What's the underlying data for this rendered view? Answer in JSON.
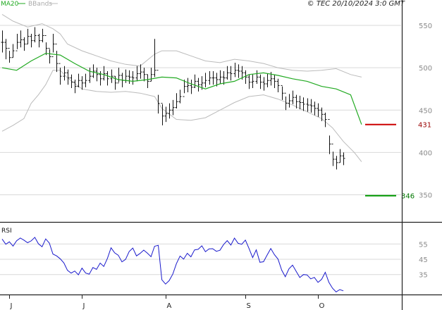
{
  "header": {
    "ma_label": "MA20",
    "bb_label": "BBands",
    "copyright": "© TEC 20/10/2024 3:0 GMT"
  },
  "colors": {
    "ma": "#22aa22",
    "bbands": "#bbbbbb",
    "bars": "#111111",
    "rsi": "#1a1acc",
    "resistance": "#cc0000",
    "support": "#009900",
    "grid": "#d9d9d9",
    "axis": "#222222"
  },
  "chart_data": [
    {
      "type": "ohlc",
      "price_axis": {
        "ylim": [
          318,
          565
        ],
        "ticks": [
          550,
          500,
          450,
          400,
          350
        ]
      },
      "x_labels": [
        {
          "label": "J",
          "index": 0
        },
        {
          "label": "J",
          "index": 20
        },
        {
          "label": "A",
          "index": 43
        },
        {
          "label": "S",
          "index": 65
        },
        {
          "label": "O",
          "index": 85
        }
      ],
      "last_index": 99,
      "close": [
        530,
        523,
        512,
        520,
        530,
        533,
        528,
        537,
        532,
        538,
        532,
        538,
        523,
        513,
        528,
        505,
        490,
        494,
        488,
        483,
        478,
        485,
        482,
        485,
        490,
        496,
        492,
        487,
        493,
        487,
        490,
        482,
        491,
        485,
        490,
        489,
        488,
        493,
        495,
        492,
        484,
        492,
        497,
        458,
        443,
        446,
        450,
        453,
        460,
        466,
        478,
        479,
        477,
        484,
        480,
        482,
        485,
        488,
        488,
        486,
        489,
        488,
        494,
        493,
        497,
        496,
        494,
        489,
        483,
        484,
        489,
        483,
        481,
        485,
        487,
        484,
        479,
        470,
        458,
        461,
        465,
        460,
        459,
        457,
        456,
        455,
        452,
        450,
        445,
        439,
        410,
        392,
        388,
        396,
        393
      ],
      "range": [
        [
          518,
          544
        ],
        [
          510,
          534
        ],
        [
          506,
          520
        ],
        [
          512,
          528
        ],
        [
          522,
          540
        ],
        [
          524,
          544
        ],
        [
          520,
          536
        ],
        [
          528,
          546
        ],
        [
          524,
          540
        ],
        [
          530,
          548
        ],
        [
          524,
          540
        ],
        [
          530,
          546
        ],
        [
          515,
          530
        ],
        [
          505,
          522
        ],
        [
          518,
          540
        ],
        [
          495,
          520
        ],
        [
          480,
          500
        ],
        [
          485,
          502
        ],
        [
          480,
          498
        ],
        [
          476,
          492
        ],
        [
          470,
          486
        ],
        [
          477,
          493
        ],
        [
          474,
          490
        ],
        [
          477,
          493
        ],
        [
          482,
          500
        ],
        [
          488,
          504
        ],
        [
          484,
          500
        ],
        [
          479,
          496
        ],
        [
          485,
          502
        ],
        [
          479,
          496
        ],
        [
          482,
          498
        ],
        [
          474,
          490
        ],
        [
          483,
          500
        ],
        [
          477,
          494
        ],
        [
          482,
          498
        ],
        [
          481,
          497
        ],
        [
          480,
          496
        ],
        [
          484,
          502
        ],
        [
          487,
          504
        ],
        [
          484,
          500
        ],
        [
          476,
          492
        ],
        [
          484,
          500
        ],
        [
          489,
          534
        ],
        [
          446,
          468
        ],
        [
          432,
          457
        ],
        [
          436,
          454
        ],
        [
          440,
          458
        ],
        [
          444,
          462
        ],
        [
          452,
          470
        ],
        [
          458,
          474
        ],
        [
          470,
          486
        ],
        [
          471,
          488
        ],
        [
          469,
          486
        ],
        [
          476,
          492
        ],
        [
          472,
          488
        ],
        [
          474,
          490
        ],
        [
          477,
          494
        ],
        [
          480,
          496
        ],
        [
          480,
          496
        ],
        [
          478,
          494
        ],
        [
          481,
          497
        ],
        [
          480,
          496
        ],
        [
          486,
          502
        ],
        [
          485,
          502
        ],
        [
          489,
          506
        ],
        [
          488,
          504
        ],
        [
          486,
          502
        ],
        [
          481,
          497
        ],
        [
          475,
          492
        ],
        [
          476,
          492
        ],
        [
          481,
          497
        ],
        [
          475,
          492
        ],
        [
          473,
          489
        ],
        [
          477,
          493
        ],
        [
          479,
          495
        ],
        [
          476,
          492
        ],
        [
          471,
          487
        ],
        [
          462,
          478
        ],
        [
          450,
          466
        ],
        [
          453,
          469
        ],
        [
          457,
          473
        ],
        [
          452,
          468
        ],
        [
          451,
          467
        ],
        [
          449,
          465
        ],
        [
          448,
          464
        ],
        [
          447,
          463
        ],
        [
          444,
          460
        ],
        [
          442,
          458
        ],
        [
          437,
          453
        ],
        [
          430,
          447
        ],
        [
          398,
          420
        ],
        [
          384,
          401
        ],
        [
          380,
          396
        ],
        [
          388,
          404
        ],
        [
          385,
          400
        ]
      ],
      "ma20": [
        [
          0,
          500
        ],
        [
          4,
          497
        ],
        [
          8,
          508
        ],
        [
          12,
          517
        ],
        [
          16,
          515
        ],
        [
          20,
          505
        ],
        [
          24,
          496
        ],
        [
          28,
          492
        ],
        [
          32,
          486
        ],
        [
          36,
          484
        ],
        [
          40,
          486
        ],
        [
          44,
          489
        ],
        [
          48,
          488
        ],
        [
          52,
          481
        ],
        [
          56,
          475
        ],
        [
          60,
          481
        ],
        [
          64,
          484
        ],
        [
          68,
          492
        ],
        [
          72,
          494
        ],
        [
          76,
          491
        ],
        [
          80,
          487
        ],
        [
          84,
          484
        ],
        [
          88,
          478
        ],
        [
          92,
          475
        ],
        [
          96,
          468
        ],
        [
          99,
          433
        ]
      ],
      "bb_upper": [
        [
          0,
          563
        ],
        [
          3,
          555
        ],
        [
          7,
          548
        ],
        [
          11,
          552
        ],
        [
          14,
          546
        ],
        [
          16,
          540
        ],
        [
          18,
          528
        ],
        [
          22,
          520
        ],
        [
          26,
          514
        ],
        [
          30,
          508
        ],
        [
          34,
          504
        ],
        [
          38,
          502
        ],
        [
          42,
          516
        ],
        [
          44,
          520
        ],
        [
          48,
          520
        ],
        [
          52,
          514
        ],
        [
          56,
          508
        ],
        [
          60,
          506
        ],
        [
          64,
          510
        ],
        [
          68,
          508
        ],
        [
          72,
          505
        ],
        [
          76,
          500
        ],
        [
          80,
          497
        ],
        [
          84,
          496
        ],
        [
          88,
          497
        ],
        [
          92,
          499
        ],
        [
          96,
          492
        ],
        [
          99,
          489
        ]
      ],
      "bb_lower": [
        [
          0,
          425
        ],
        [
          3,
          432
        ],
        [
          6,
          440
        ],
        [
          8,
          458
        ],
        [
          10,
          468
        ],
        [
          12,
          480
        ],
        [
          14,
          497
        ],
        [
          16,
          497
        ],
        [
          18,
          488
        ],
        [
          22,
          475
        ],
        [
          26,
          472
        ],
        [
          30,
          471
        ],
        [
          34,
          472
        ],
        [
          38,
          470
        ],
        [
          42,
          466
        ],
        [
          44,
          452
        ],
        [
          48,
          439
        ],
        [
          52,
          438
        ],
        [
          56,
          441
        ],
        [
          60,
          450
        ],
        [
          64,
          459
        ],
        [
          68,
          466
        ],
        [
          72,
          468
        ],
        [
          76,
          463
        ],
        [
          80,
          456
        ],
        [
          84,
          448
        ],
        [
          88,
          440
        ],
        [
          91,
          429
        ],
        [
          94,
          413
        ],
        [
          97,
          400
        ],
        [
          99,
          389
        ]
      ],
      "levels": [
        {
          "label": "431",
          "value": 433,
          "kind": "resistance"
        },
        {
          "label": "346",
          "value": 349,
          "kind": "support"
        }
      ]
    },
    {
      "type": "line",
      "title": "RSI",
      "ylim": [
        22,
        68
      ],
      "ticks": [
        {
          "label": "55",
          "value": 55
        },
        {
          "label": "45",
          "value": 45
        },
        {
          "label": "35",
          "value": 35
        }
      ],
      "values": [
        58.2,
        54.8,
        56.4,
        53.6,
        57.1,
        58.9,
        57.5,
        55.8,
        57.0,
        59.3,
        55.1,
        53.2,
        58.3,
        55.6,
        48.4,
        47.2,
        45.3,
        42.6,
        37.8,
        36.0,
        37.3,
        34.9,
        39.2,
        36.0,
        35.3,
        39.6,
        38.4,
        42.5,
        40.3,
        45.6,
        52.5,
        49.2,
        47.6,
        43.3,
        44.9,
        50.1,
        52.3,
        47.2,
        48.8,
        51.0,
        49.0,
        46.7,
        53.5,
        54.1,
        31.6,
        28.8,
        31.0,
        35.3,
        42.1,
        47.1,
        45.1,
        48.9,
        46.6,
        51.1,
        51.5,
        53.8,
        49.9,
        51.8,
        51.9,
        50.2,
        50.9,
        54.6,
        57.2,
        54.3,
        58.8,
        55.4,
        54.8,
        57.5,
        52.1,
        46.1,
        51.1,
        43.0,
        43.4,
        47.8,
        52.0,
        48.0,
        45.1,
        37.9,
        33.6,
        38.8,
        41.2,
        37.1,
        33.1,
        35.0,
        34.8,
        32.2,
        33.2,
        29.9,
        31.9,
        36.5,
        30.0,
        26.1,
        23.7,
        25.2,
        24.4
      ]
    }
  ]
}
